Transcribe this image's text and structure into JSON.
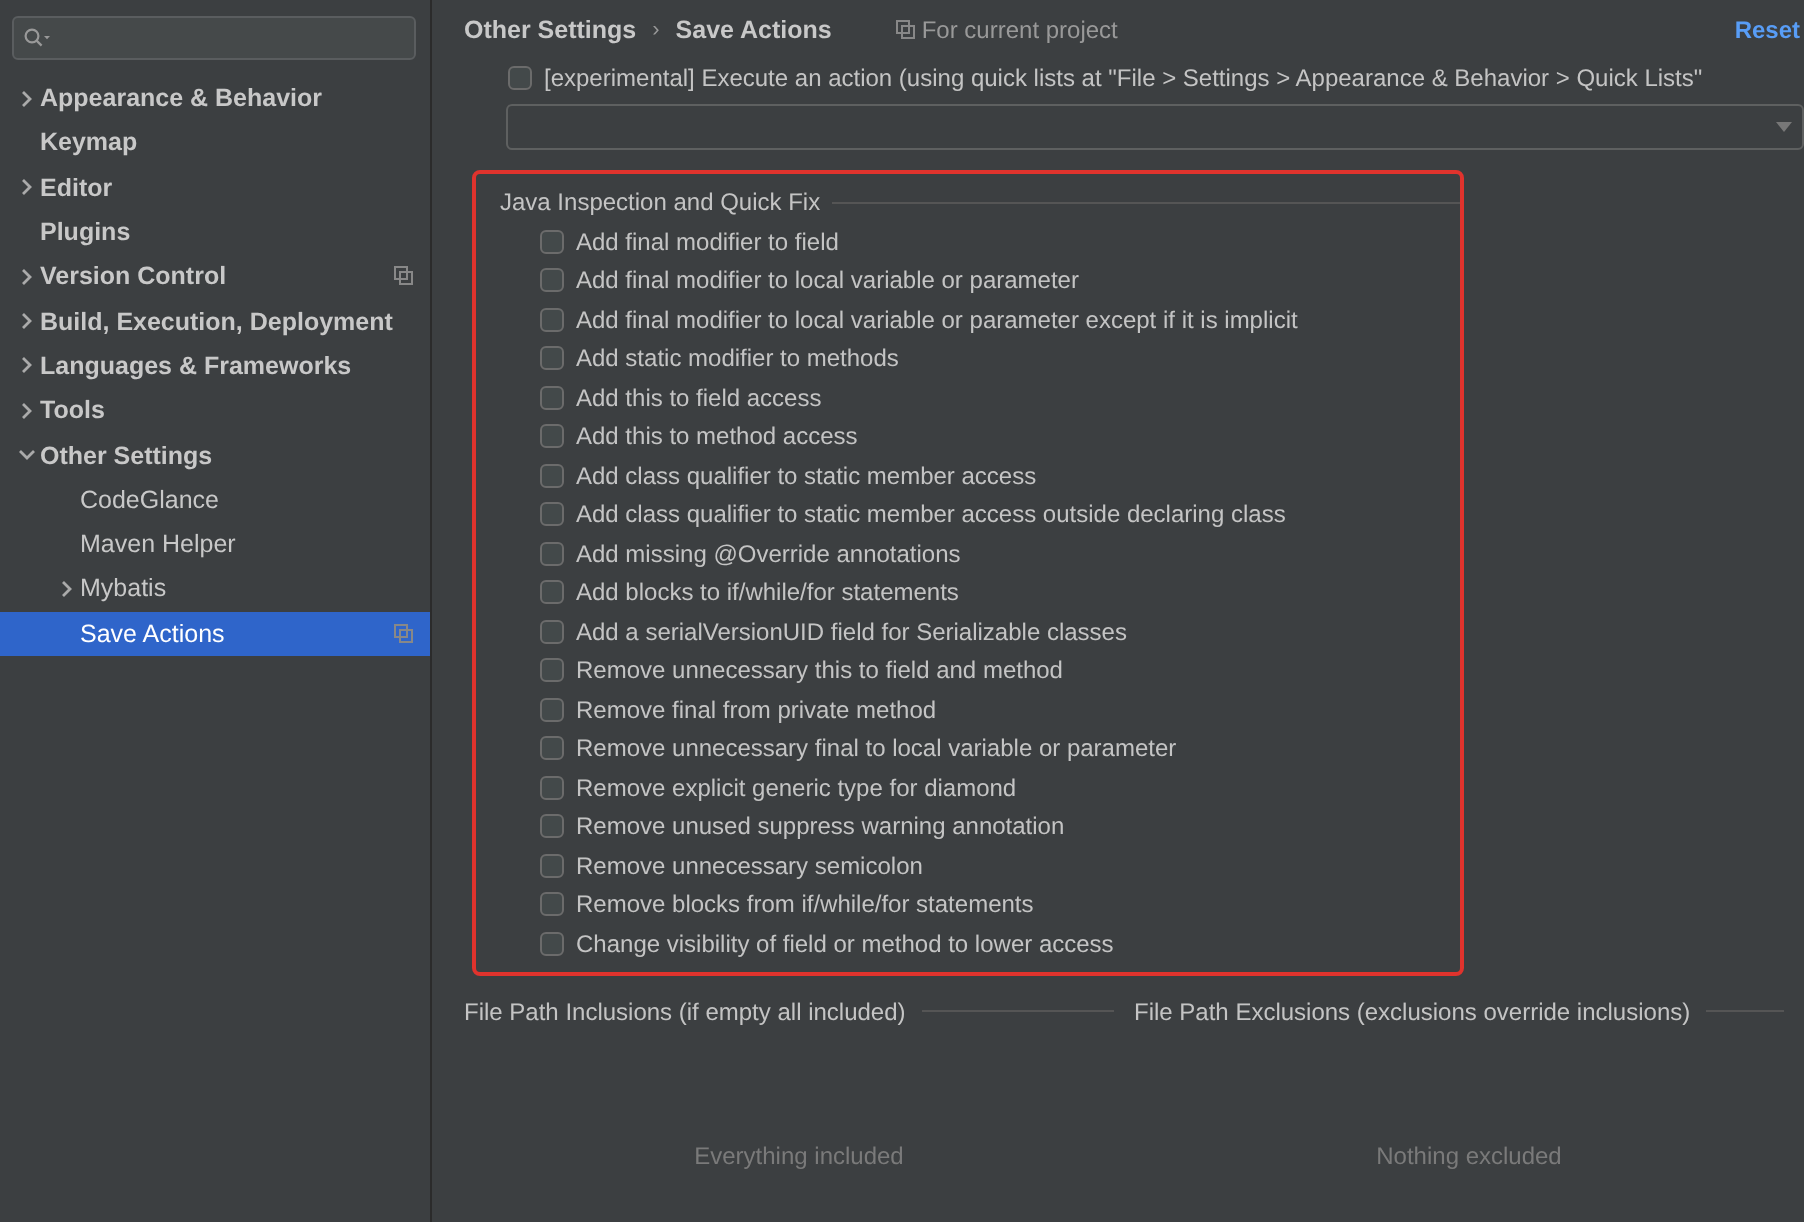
{
  "sidebar": {
    "items": [
      {
        "label": "Appearance & Behavior",
        "expanded": false,
        "selected": false
      },
      {
        "label": "Keymap",
        "selected": false
      },
      {
        "label": "Editor",
        "expanded": false,
        "selected": false
      },
      {
        "label": "Plugins",
        "selected": false
      },
      {
        "label": "Version Control",
        "expanded": false,
        "selected": false,
        "project_scope": true
      },
      {
        "label": "Build, Execution, Deployment",
        "expanded": false,
        "selected": false
      },
      {
        "label": "Languages & Frameworks",
        "expanded": false,
        "selected": false
      },
      {
        "label": "Tools",
        "expanded": false,
        "selected": false
      },
      {
        "label": "Other Settings",
        "expanded": true,
        "selected": false,
        "children": [
          {
            "label": "CodeGlance",
            "selected": false
          },
          {
            "label": "Maven Helper",
            "selected": false
          },
          {
            "label": "Mybatis",
            "expanded": false,
            "selected": false
          },
          {
            "label": "Save Actions",
            "selected": true,
            "project_scope": true
          }
        ]
      }
    ]
  },
  "header": {
    "breadcrumb": [
      "Other Settings",
      "Save Actions"
    ],
    "separator": "›",
    "scope": "For current project",
    "reset": "Reset"
  },
  "experimental": {
    "label": "[experimental] Execute an action (using quick lists at \"File > Settings > Appearance & Behavior > Quick Lists\"",
    "checked": false
  },
  "java_inspection": {
    "title": "Java Inspection and Quick Fix",
    "highlighted": true,
    "options": [
      {
        "label": "Add final modifier to field",
        "checked": false
      },
      {
        "label": "Add final modifier to local variable or parameter",
        "checked": false
      },
      {
        "label": "Add final modifier to local variable or parameter except if it is implicit",
        "checked": false
      },
      {
        "label": "Add static modifier to methods",
        "checked": false
      },
      {
        "label": "Add this to field access",
        "checked": false
      },
      {
        "label": "Add this to method access",
        "checked": false
      },
      {
        "label": "Add class qualifier to static member access",
        "checked": false
      },
      {
        "label": "Add class qualifier to static member access outside declaring class",
        "checked": false
      },
      {
        "label": "Add missing @Override annotations",
        "checked": false
      },
      {
        "label": "Add blocks to if/while/for statements",
        "checked": false
      },
      {
        "label": "Add a serialVersionUID field for Serializable classes",
        "checked": false
      },
      {
        "label": "Remove unnecessary this to field and method",
        "checked": false
      },
      {
        "label": "Remove final from private method",
        "checked": false
      },
      {
        "label": "Remove unnecessary final to local variable or parameter",
        "checked": false
      },
      {
        "label": "Remove explicit generic type for diamond",
        "checked": false
      },
      {
        "label": "Remove unused suppress warning annotation",
        "checked": false
      },
      {
        "label": "Remove unnecessary semicolon",
        "checked": false
      },
      {
        "label": "Remove blocks from if/while/for statements",
        "checked": false
      },
      {
        "label": "Change visibility of field or method to lower access",
        "checked": false
      }
    ]
  },
  "file_paths": [
    {
      "title": "File Path Inclusions (if empty all included)",
      "empty_text": "Everything included"
    },
    {
      "title": "File Path Exclusions (exclusions override inclusions)",
      "empty_text": "Nothing excluded"
    }
  ]
}
